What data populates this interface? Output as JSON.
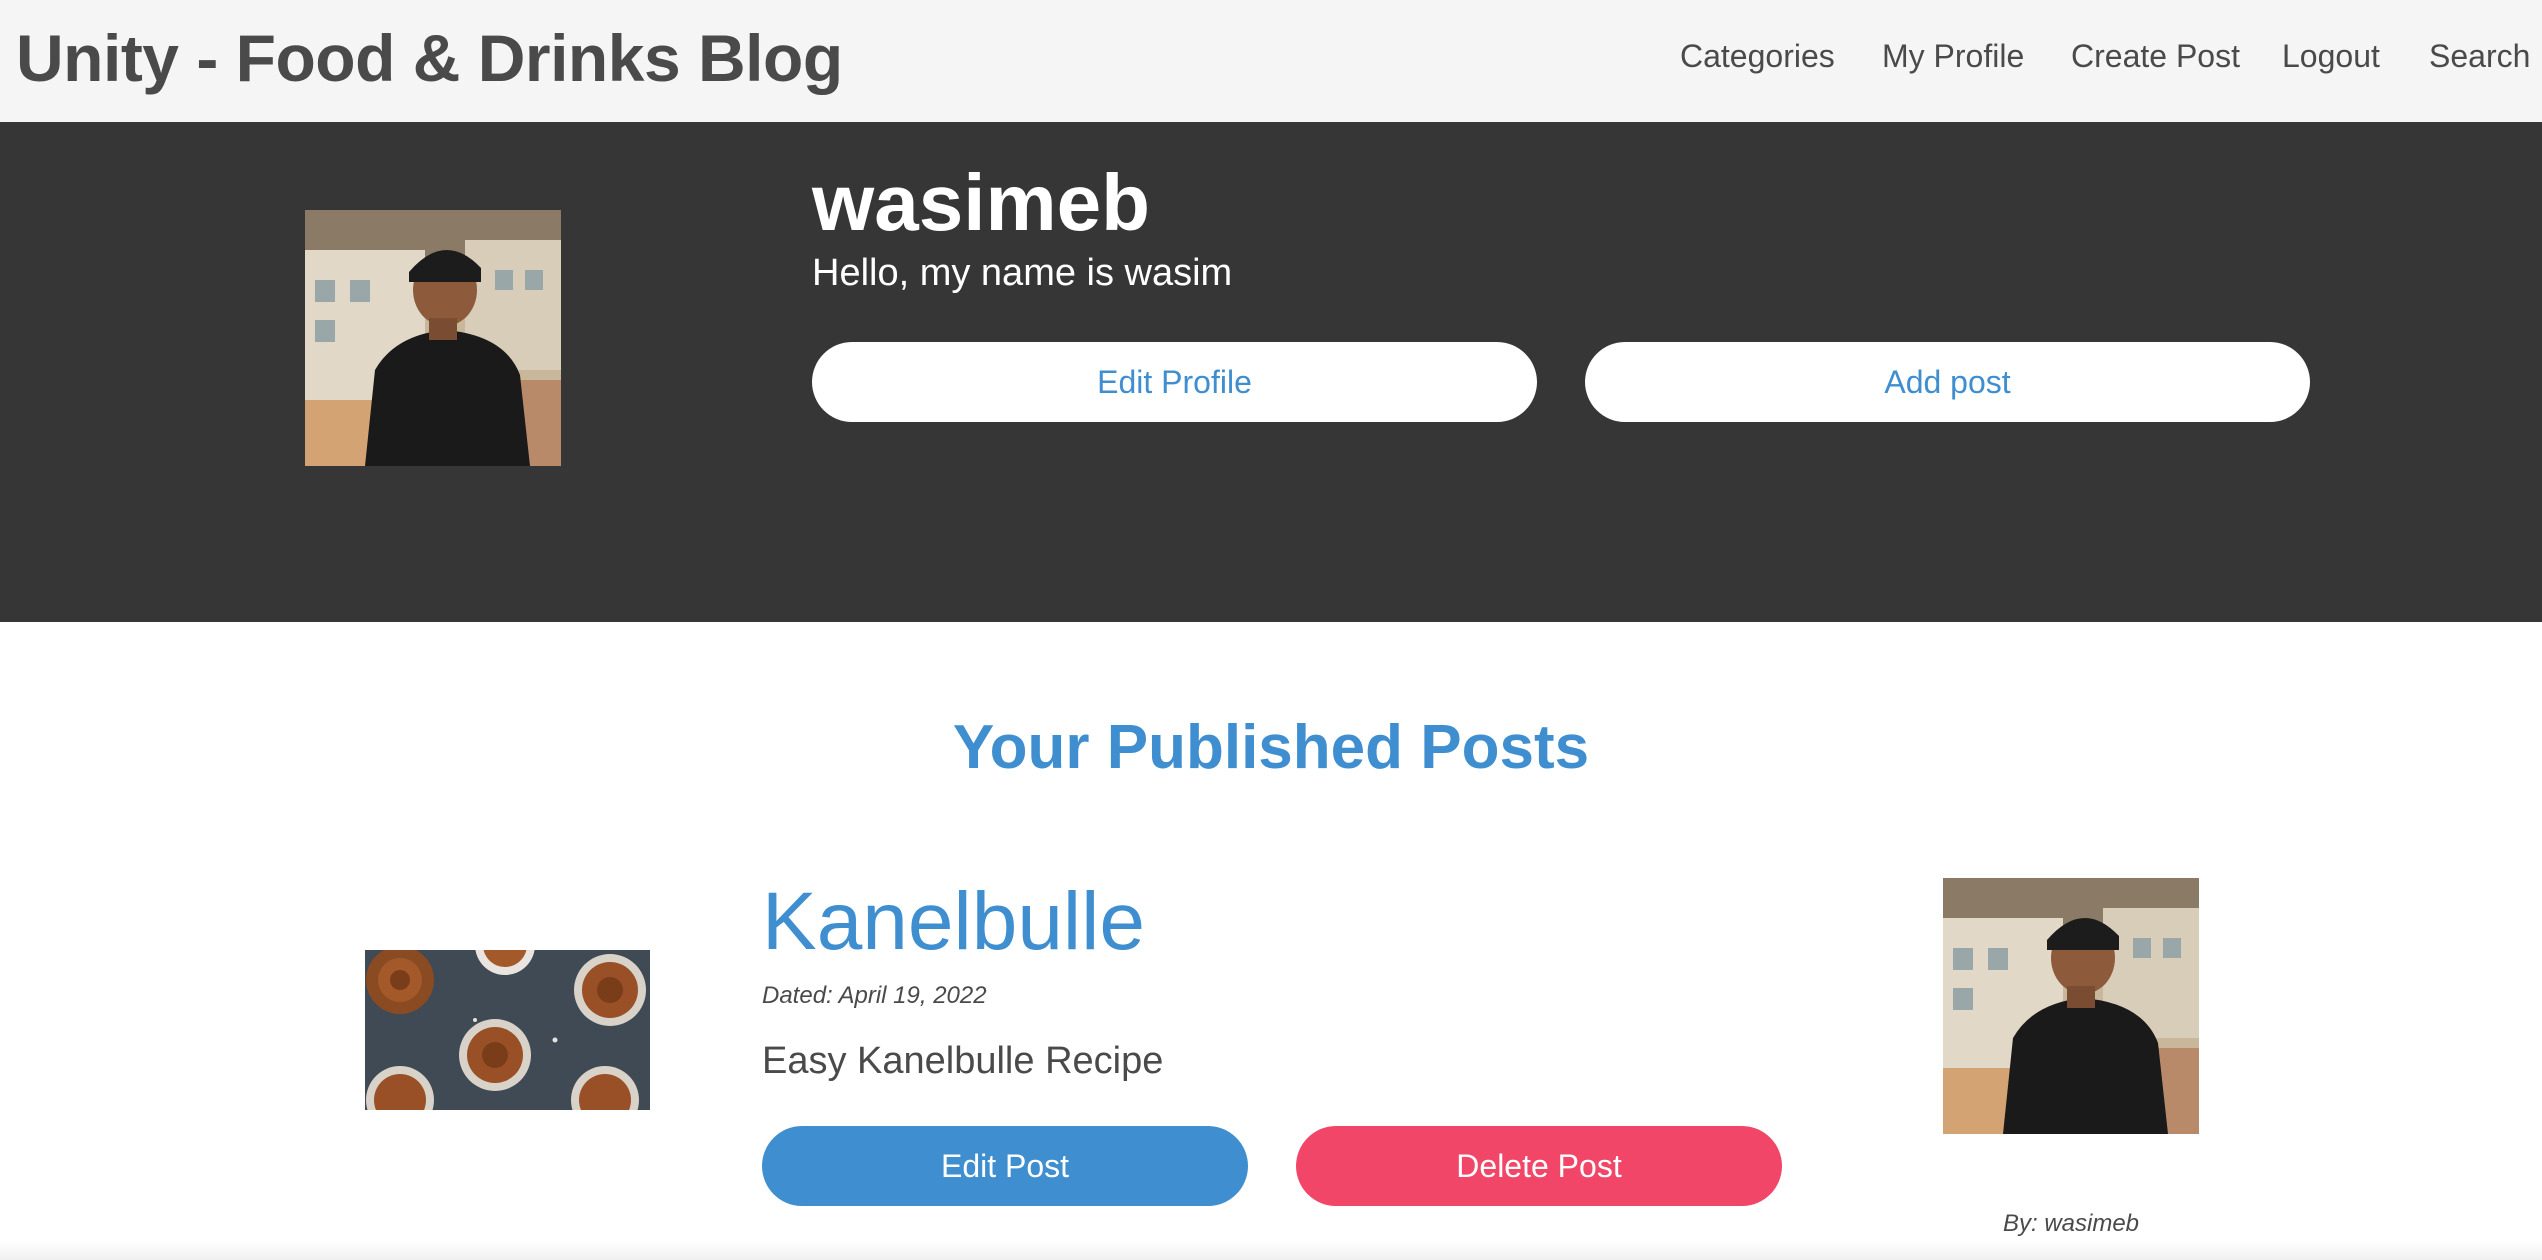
{
  "navbar": {
    "brand": "Unity - Food & Drinks Blog",
    "items": [
      {
        "label": "Categories"
      },
      {
        "label": "My Profile"
      },
      {
        "label": "Create Post"
      },
      {
        "label": "Logout"
      },
      {
        "label": "Search"
      }
    ]
  },
  "profile": {
    "username": "wasimeb",
    "bio": "Hello, my name is wasim",
    "edit_profile_label": "Edit Profile",
    "add_post_label": "Add post"
  },
  "posts_section": {
    "title": "Your Published Posts",
    "posts": [
      {
        "title": "Kanelbulle",
        "date": "Dated: April 19, 2022",
        "description": "Easy Kanelbulle Recipe",
        "edit_label": "Edit Post",
        "delete_label": "Delete Post",
        "byline": "By: wasimeb"
      }
    ]
  },
  "colors": {
    "primary": "#3e8ed0",
    "danger": "#f14668",
    "hero_bg": "#363636",
    "navbar_bg": "#f5f5f5",
    "text": "#4a4a4a"
  }
}
